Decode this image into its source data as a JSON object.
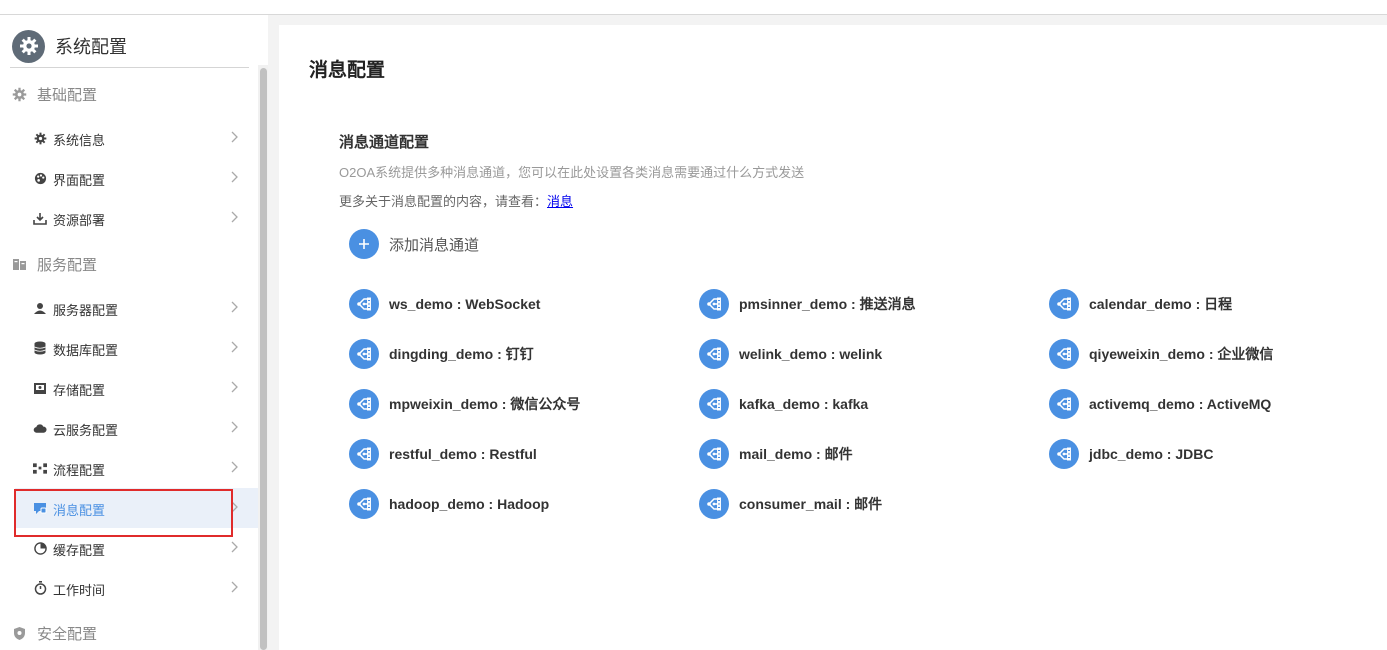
{
  "sidebar": {
    "app_title": "系统配置",
    "groups": [
      {
        "label": "基础配置",
        "icon": "gear-icon"
      },
      {
        "label": "服务配置",
        "icon": "server-icon"
      },
      {
        "label": "安全配置",
        "icon": "shield-icon"
      }
    ],
    "items": [
      {
        "label": "系统信息",
        "icon": "gear-icon"
      },
      {
        "label": "界面配置",
        "icon": "palette-icon"
      },
      {
        "label": "资源部署",
        "icon": "deploy-icon"
      },
      {
        "label": "服务器配置",
        "icon": "server-user-icon"
      },
      {
        "label": "数据库配置",
        "icon": "database-icon"
      },
      {
        "label": "存储配置",
        "icon": "storage-icon"
      },
      {
        "label": "云服务配置",
        "icon": "cloud-icon"
      },
      {
        "label": "流程配置",
        "icon": "flow-icon"
      },
      {
        "label": "消息配置",
        "icon": "message-icon",
        "active": true
      },
      {
        "label": "缓存配置",
        "icon": "pie-icon"
      },
      {
        "label": "工作时间",
        "icon": "stopwatch-icon"
      }
    ]
  },
  "main": {
    "page_title": "消息配置",
    "section_title": "消息通道配置",
    "description": "O2OA系统提供多种消息通道，您可以在此处设置各类消息需要通过什么方式发送",
    "more_prefix": "更多关于消息配置的内容，请查看：",
    "more_link": "消息",
    "add_label": "添加消息通道",
    "add_icon": "plus-icon",
    "channel_icon": "channel-icon",
    "channels": [
      "ws_demo : WebSocket",
      "pmsinner_demo : 推送消息",
      "calendar_demo : 日程",
      "dingding_demo : 钉钉",
      "welink_demo : welink",
      "qiyeweixin_demo : 企业微信",
      "mpweixin_demo : 微信公众号",
      "kafka_demo : kafka",
      "activemq_demo : ActiveMQ",
      "restful_demo : Restful",
      "mail_demo : 邮件",
      "jdbc_demo : JDBC",
      "hadoop_demo : Hadoop",
      "consumer_mail : 邮件"
    ]
  },
  "colors": {
    "accent": "#4a90e2",
    "active_bg": "#eaf0f9",
    "highlight_border": "#e02b2b",
    "muted_text": "#999999"
  }
}
